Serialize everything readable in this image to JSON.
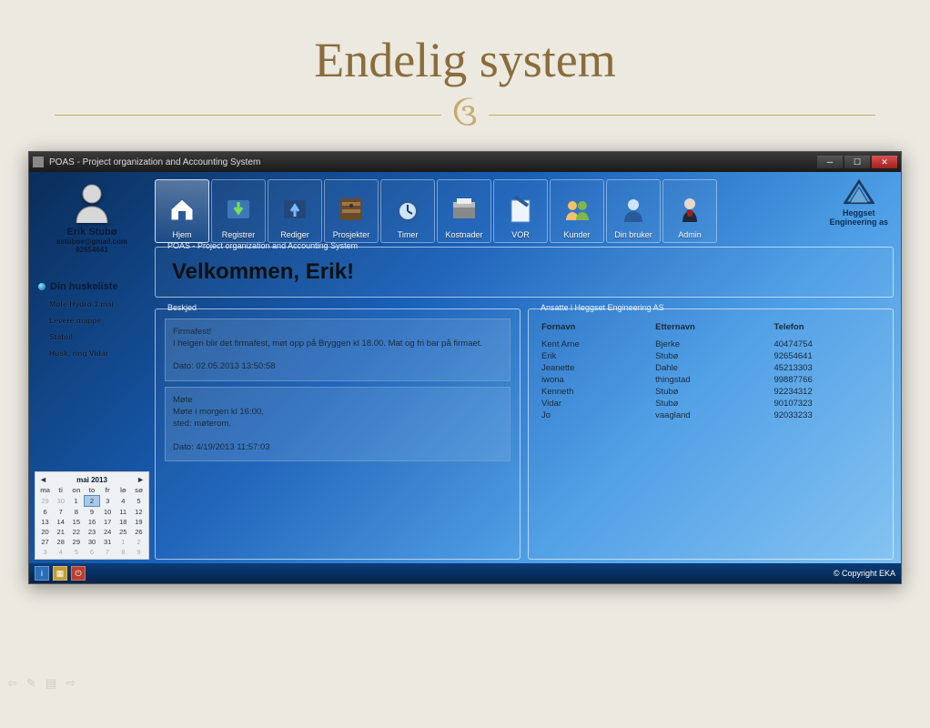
{
  "slide": {
    "title": "Endelig system"
  },
  "window": {
    "title": "POAS - Project organization and Accounting System"
  },
  "user": {
    "name": "Erik Stubø",
    "email": "estuboe@gmail.com",
    "phone": "92654641"
  },
  "tasks": {
    "title": "Din huskeliste",
    "items": [
      "Møte Hydro 3.mai",
      "Levere mappe",
      "Statoil",
      "Husk, ring Vidar"
    ]
  },
  "calendar": {
    "month": "mai 2013",
    "dow": [
      "ma",
      "ti",
      "on",
      "to",
      "fr",
      "lø",
      "sø"
    ],
    "rows": [
      [
        {
          "d": "29",
          "o": true
        },
        {
          "d": "30",
          "o": true
        },
        {
          "d": "1"
        },
        {
          "d": "2",
          "sel": true
        },
        {
          "d": "3"
        },
        {
          "d": "4"
        },
        {
          "d": "5"
        }
      ],
      [
        {
          "d": "6"
        },
        {
          "d": "7"
        },
        {
          "d": "8"
        },
        {
          "d": "9"
        },
        {
          "d": "10"
        },
        {
          "d": "11"
        },
        {
          "d": "12"
        }
      ],
      [
        {
          "d": "13"
        },
        {
          "d": "14"
        },
        {
          "d": "15"
        },
        {
          "d": "16"
        },
        {
          "d": "17"
        },
        {
          "d": "18"
        },
        {
          "d": "19"
        }
      ],
      [
        {
          "d": "20"
        },
        {
          "d": "21"
        },
        {
          "d": "22"
        },
        {
          "d": "23"
        },
        {
          "d": "24"
        },
        {
          "d": "25"
        },
        {
          "d": "26"
        }
      ],
      [
        {
          "d": "27"
        },
        {
          "d": "28"
        },
        {
          "d": "29"
        },
        {
          "d": "30"
        },
        {
          "d": "31"
        },
        {
          "d": "1",
          "o": true
        },
        {
          "d": "2",
          "o": true
        }
      ],
      [
        {
          "d": "3",
          "o": true
        },
        {
          "d": "4",
          "o": true
        },
        {
          "d": "5",
          "o": true
        },
        {
          "d": "6",
          "o": true
        },
        {
          "d": "7",
          "o": true
        },
        {
          "d": "8",
          "o": true
        },
        {
          "d": "9",
          "o": true
        }
      ]
    ]
  },
  "toolbar": [
    {
      "label": "Hjem",
      "active": true
    },
    {
      "label": "Registrer"
    },
    {
      "label": "Rediger"
    },
    {
      "label": "Prosjekter"
    },
    {
      "label": "Timer"
    },
    {
      "label": "Kostnader"
    },
    {
      "label": "VOR"
    },
    {
      "label": "Kunder"
    },
    {
      "label": "Din bruker"
    },
    {
      "label": "Admin"
    }
  ],
  "company": {
    "line1": "Heggset",
    "line2": "Engineering as"
  },
  "welcome_panel": {
    "legend": "POAS - Project organization and Accounting System",
    "text": "Velkommen, Erik!"
  },
  "messages": {
    "legend": "Beskjed",
    "items": [
      {
        "title": "Firmafest!",
        "body": "I helgen blir det firmafest, møt opp på Bryggen kl 18.00. Mat og fri bar på firmaet.",
        "date": "Dato: 02.05.2013 13:50:58"
      },
      {
        "title": "Møte",
        "body": "Møte i morgen kl 16:00,\nsted: møterom.",
        "date": "Dato: 4/19/2013 11:57:03"
      }
    ]
  },
  "employees": {
    "legend": "Ansatte i Heggset Engineering AS",
    "headers": [
      "Fornavn",
      "Etternavn",
      "Telefon"
    ],
    "rows": [
      [
        "Kent Arne",
        "Bjerke",
        "40474754"
      ],
      [
        "Erik",
        "Stubø",
        "92654641"
      ],
      [
        "Jeanette",
        "Dahle",
        "45213303"
      ],
      [
        "iwona",
        "thingstad",
        "99887766"
      ],
      [
        "Kenneth",
        "Stubø",
        "92234312"
      ],
      [
        "Vidar",
        "Stubø",
        "90107323"
      ],
      [
        "Jo",
        "vaagland",
        "92033233"
      ]
    ]
  },
  "footer": {
    "copyright": "© Copyright EKA"
  }
}
